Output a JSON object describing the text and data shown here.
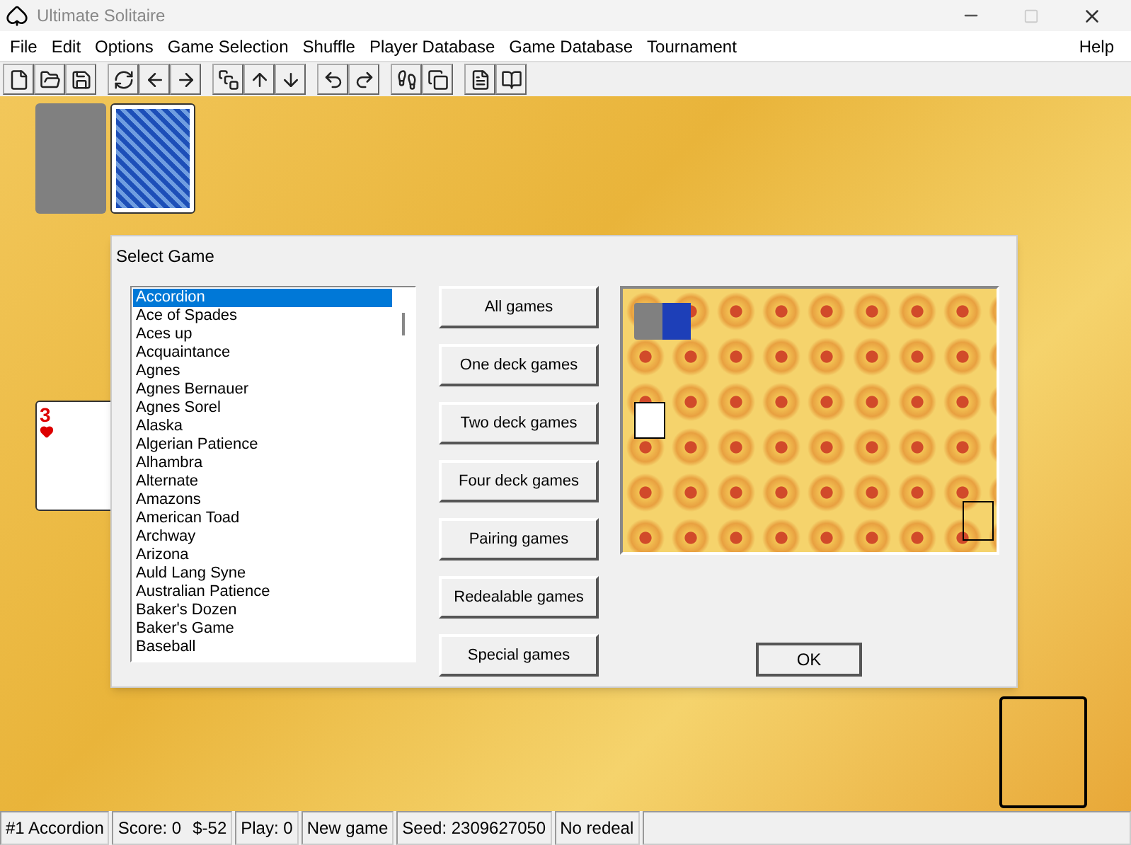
{
  "window": {
    "title": "Ultimate Solitaire"
  },
  "menu": [
    "File",
    "Edit",
    "Options",
    "Game Selection",
    "Shuffle",
    "Player Database",
    "Game Database",
    "Tournament"
  ],
  "menu_right": "Help",
  "table_cards": [
    {
      "kind": "stock"
    },
    {
      "kind": "back"
    }
  ],
  "side_card": {
    "rank": "3"
  },
  "dialog": {
    "title": "Select Game",
    "games": [
      {
        "label": "Accordion",
        "selected": true
      },
      {
        "label": "Ace of Spades",
        "selected": false
      },
      {
        "label": "Aces up",
        "selected": false
      },
      {
        "label": "Acquaintance",
        "selected": false
      },
      {
        "label": "Agnes",
        "selected": false
      },
      {
        "label": "Agnes Bernauer",
        "selected": false
      },
      {
        "label": "Agnes Sorel",
        "selected": false
      },
      {
        "label": "Alaska",
        "selected": false
      },
      {
        "label": "Algerian Patience",
        "selected": false
      },
      {
        "label": "Alhambra",
        "selected": false
      },
      {
        "label": "Alternate",
        "selected": false
      },
      {
        "label": "Amazons",
        "selected": false
      },
      {
        "label": "American Toad",
        "selected": false
      },
      {
        "label": "Archway",
        "selected": false
      },
      {
        "label": "Arizona",
        "selected": false
      },
      {
        "label": "Auld Lang Syne",
        "selected": false
      },
      {
        "label": "Australian Patience",
        "selected": false
      },
      {
        "label": "Baker's Dozen",
        "selected": false
      },
      {
        "label": "Baker's Game",
        "selected": false
      },
      {
        "label": "Baseball",
        "selected": false
      }
    ],
    "filters": [
      "All games",
      "One deck games",
      "Two deck games",
      "Four deck games",
      "Pairing games",
      "Redealable games",
      "Special games"
    ],
    "ok": "OK"
  },
  "status_bar": [
    {
      "texts": [
        "#1 Accordion"
      ]
    },
    {
      "texts": [
        "Score: 0",
        "$-52"
      ]
    },
    {
      "texts": [
        "Play: 0"
      ]
    },
    {
      "texts": [
        "New game"
      ]
    },
    {
      "texts": [
        "Seed: 2309627050"
      ]
    },
    {
      "texts": [
        "No redeal"
      ]
    }
  ]
}
